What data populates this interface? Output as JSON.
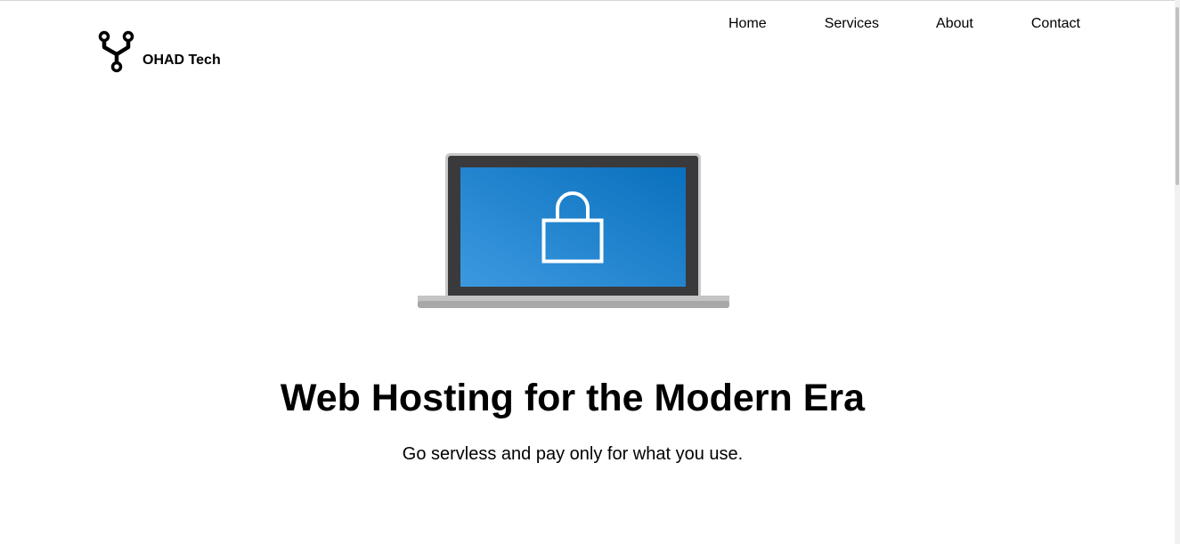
{
  "header": {
    "brand": "OHAD Tech",
    "logo_icon": "circuit-fork-icon"
  },
  "nav": {
    "items": [
      {
        "label": "Home"
      },
      {
        "label": "Services"
      },
      {
        "label": "About"
      },
      {
        "label": "Contact"
      }
    ]
  },
  "hero": {
    "illustration": "laptop-lock-icon",
    "title": "Web Hosting for the Modern Era",
    "subtitle": "Go servless and pay only for what you use."
  },
  "colors": {
    "screen_blue": "#1a7fcf",
    "laptop_frame": "#3a3a3c",
    "laptop_base": "#c4c4c4"
  }
}
